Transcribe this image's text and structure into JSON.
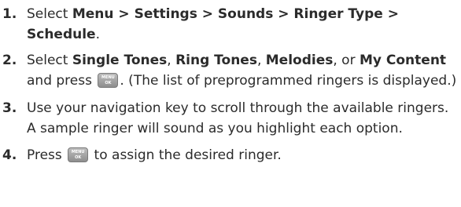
{
  "steps": [
    {
      "num": "1.",
      "t1": "Select ",
      "b1": "Menu > Settings > Sounds > Ringer Type > Schedule",
      "t2": "."
    },
    {
      "num": "2.",
      "t1": "Select ",
      "b1": "Single Tones",
      "t2": ", ",
      "b2": "Ring Tones",
      "t3": ", ",
      "b3": "Melodies",
      "t4": ", or ",
      "b4": "My Content",
      "t5": " and press ",
      "t6": ". (The list of preprogrammed ringers is displayed.)"
    },
    {
      "num": "3.",
      "t1": "Use your navigation key to scroll through the available ringers. A sample ringer will sound as you highlight each option."
    },
    {
      "num": "4.",
      "t1": "Press ",
      "t2": " to assign the desired ringer."
    }
  ],
  "key_icon": {
    "name": "menu-ok-key-icon",
    "top_text": "MENU",
    "bottom_text": "OK",
    "color": "#9e9e9e"
  }
}
